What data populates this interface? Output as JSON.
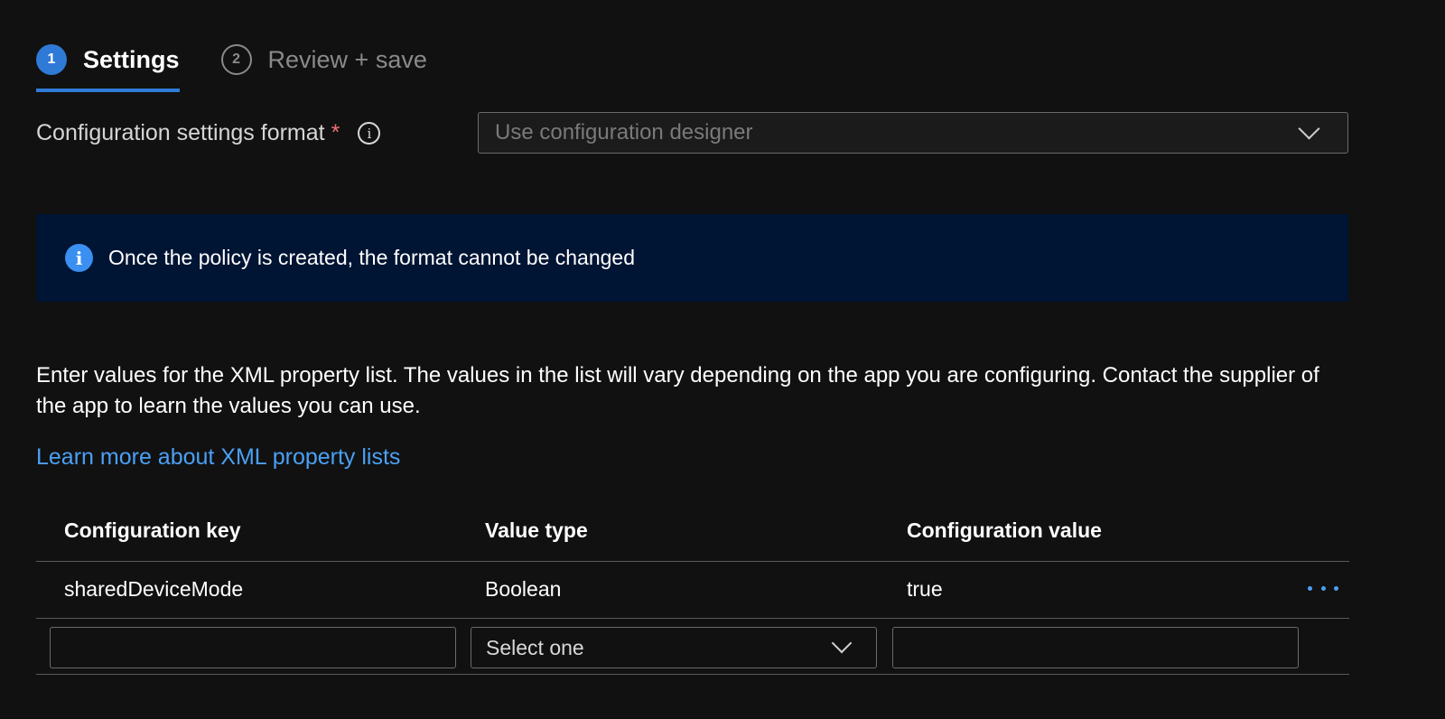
{
  "wizard": {
    "steps": [
      {
        "number": "1",
        "label": "Settings"
      },
      {
        "number": "2",
        "label": "Review + save"
      }
    ]
  },
  "format": {
    "label": "Configuration settings format",
    "required_mark": "*",
    "info_glyph": "i",
    "selected_value": "Use configuration designer"
  },
  "banner": {
    "info_glyph": "i",
    "text": "Once the policy is created, the format cannot be changed"
  },
  "description": "Enter values for the XML property list. The values in the list will vary depending on the app you are configuring. Contact the supplier of the app to learn the values you can use.",
  "learn_more_link": "Learn more about XML property lists",
  "table": {
    "headers": [
      "Configuration key",
      "Value type",
      "Configuration value"
    ],
    "rows": [
      {
        "key": "sharedDeviceMode",
        "type": "Boolean",
        "value": "true"
      }
    ],
    "new_row": {
      "key_value": "",
      "type_selected": "Select one",
      "config_value": ""
    }
  },
  "colors": {
    "background": "#111111",
    "accent": "#2f7ad6",
    "link": "#4ba0f5",
    "banner_bg": "#001433",
    "required": "#f1707b"
  },
  "icons": {
    "format_info": "info-circle-outline-icon",
    "banner_info": "info-circle-filled-icon",
    "row_actions": "ellipsis-icon",
    "dropdown": "chevron-down-icon"
  }
}
